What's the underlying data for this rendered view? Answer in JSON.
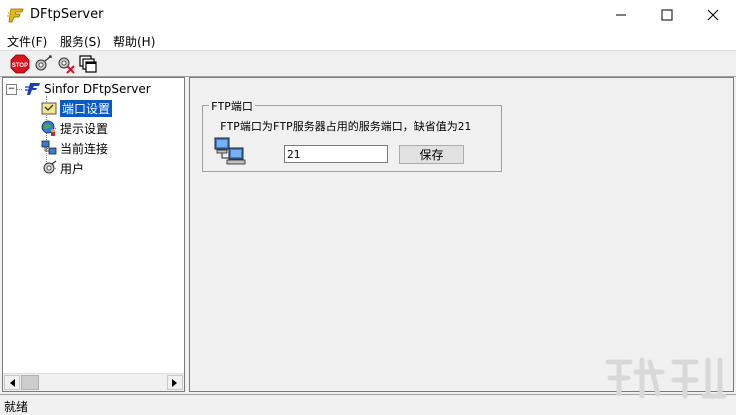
{
  "window": {
    "title": "DFtpServer"
  },
  "menu": {
    "file": "文件(F)",
    "service": "服务(S)",
    "help": "帮助(H)"
  },
  "toolbar": {
    "stop_label": "STOP"
  },
  "tree": {
    "root": "Sinfor DFtpServer",
    "expander": "−",
    "items": [
      {
        "label": "端口设置",
        "selected": true
      },
      {
        "label": "提示设置"
      },
      {
        "label": "当前连接"
      },
      {
        "label": "用户"
      }
    ]
  },
  "port": {
    "group_title": "FTP端口",
    "description": "FTP端口为FTP服务器占用的服务端口，缺省值为21",
    "value": "21",
    "save_label": "保存"
  },
  "status": {
    "text": "就绪"
  },
  "colors": {
    "selection": "#0a58c9",
    "stop_red": "#d8141c"
  }
}
